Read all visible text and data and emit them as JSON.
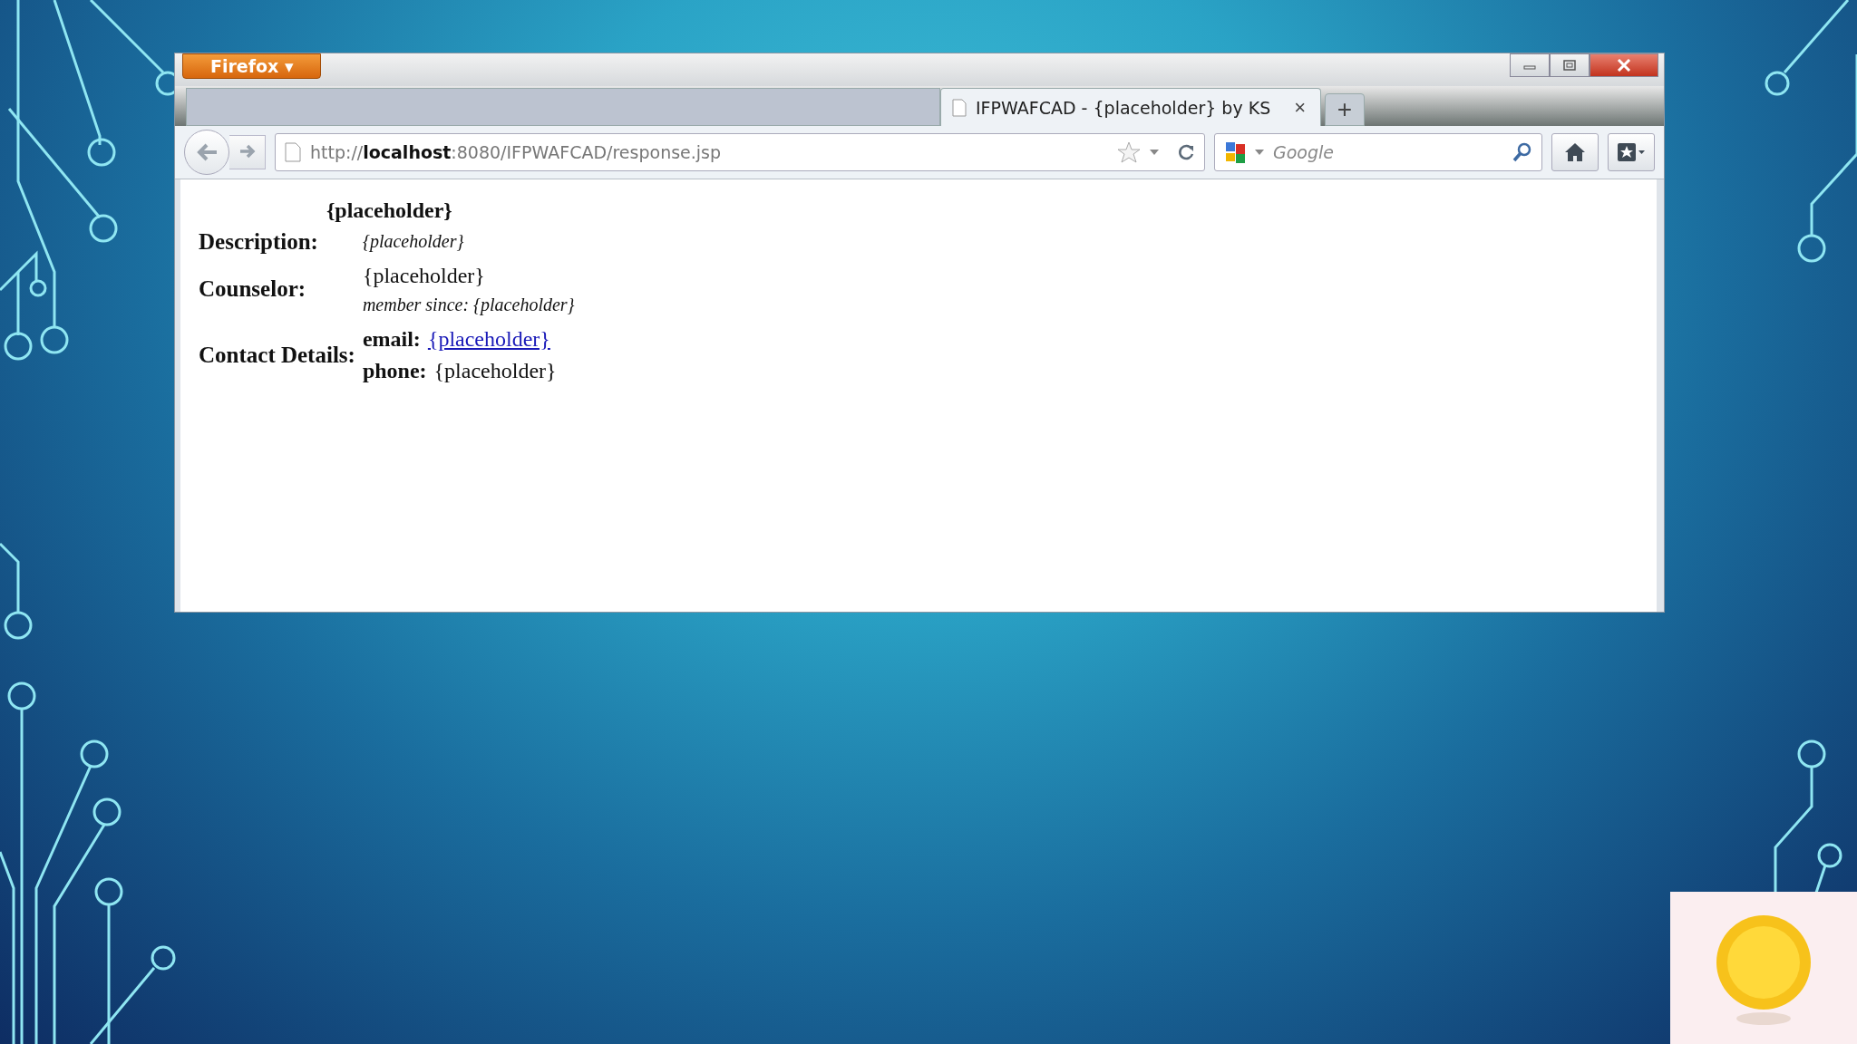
{
  "browser": {
    "menu_button": "Firefox ▾",
    "tabs": [
      {
        "title": "IFPWAFCAD - {placeholder} by KS",
        "close": "×",
        "selected": true
      }
    ],
    "new_tab": "+",
    "url": "http://**localhost**:8080/IFPWAFCAD/response.jsp",
    "search": {
      "placeholder": "Google"
    }
  },
  "page": {
    "heading": "{placeholder}",
    "rows": [
      {
        "label": "Description:",
        "lines": [
          {
            "kind": "note",
            "text": "{placeholder}"
          }
        ]
      },
      {
        "label": "Counselor:",
        "lines": [
          {
            "kind": "plain",
            "text": "{placeholder}"
          },
          {
            "kind": "note",
            "text": "member since: {placeholder}"
          }
        ]
      },
      {
        "label": "Contact Details:",
        "lines": [
          {
            "kind": "link",
            "key": "email:",
            "text": "{placeholder}"
          },
          {
            "kind": "field",
            "key": "phone:",
            "text": "{placeholder}"
          }
        ]
      }
    ]
  }
}
